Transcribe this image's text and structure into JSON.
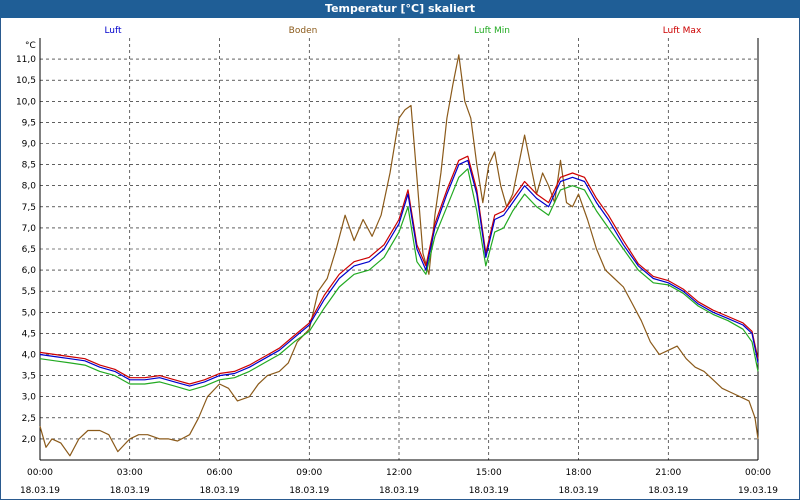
{
  "window": {
    "title": "Temperatur [°C] skaliert"
  },
  "chart_data": {
    "type": "line",
    "title": "Temperatur [°C] skaliert",
    "ylabel": "°C",
    "xlabel": "",
    "ylim": [
      1.5,
      11.5
    ],
    "xlim": [
      0,
      24
    ],
    "grid": true,
    "legend_placement": "top",
    "y_ticks": [
      "2,0",
      "2,5",
      "3,0",
      "3,5",
      "4,0",
      "4,5",
      "5,0",
      "5,5",
      "6,0",
      "6,5",
      "7,0",
      "7,5",
      "8,0",
      "8,5",
      "9,0",
      "9,5",
      "10,0",
      "10,5",
      "11,0"
    ],
    "x_ticks": [
      {
        "time": "00:00",
        "date": "18.03.19"
      },
      {
        "time": "03:00",
        "date": "18.03.19"
      },
      {
        "time": "06:00",
        "date": "18.03.19"
      },
      {
        "time": "09:00",
        "date": "18.03.19"
      },
      {
        "time": "12:00",
        "date": "18.03.19"
      },
      {
        "time": "15:00",
        "date": "18.03.19"
      },
      {
        "time": "18:00",
        "date": "18.03.19"
      },
      {
        "time": "21:00",
        "date": "18.03.19"
      },
      {
        "time": "00:00",
        "date": "19.03.19"
      }
    ],
    "series": [
      {
        "name": "Luft",
        "color": "#0000cc",
        "x": [
          0,
          0.5,
          1,
          1.5,
          2,
          2.5,
          3,
          3.5,
          4,
          4.5,
          5,
          5.5,
          6,
          6.5,
          7,
          7.5,
          8,
          8.5,
          9,
          9.5,
          10,
          10.5,
          11,
          11.5,
          12,
          12.3,
          12.6,
          12.9,
          13.2,
          13.6,
          14,
          14.3,
          14.6,
          14.9,
          15.2,
          15.5,
          15.8,
          16.2,
          16.6,
          17,
          17.4,
          17.8,
          18.2,
          18.6,
          19,
          19.5,
          20,
          20.5,
          21,
          21.5,
          22,
          22.5,
          23,
          23.5,
          23.8,
          24
        ],
        "y": [
          4.0,
          3.95,
          3.9,
          3.85,
          3.7,
          3.6,
          3.4,
          3.4,
          3.45,
          3.35,
          3.25,
          3.35,
          3.5,
          3.55,
          3.7,
          3.9,
          4.1,
          4.4,
          4.7,
          5.3,
          5.8,
          6.1,
          6.2,
          6.5,
          7.1,
          7.8,
          6.5,
          6.0,
          7.0,
          7.8,
          8.5,
          8.6,
          7.8,
          6.3,
          7.2,
          7.3,
          7.6,
          8.0,
          7.7,
          7.5,
          8.1,
          8.2,
          8.1,
          7.6,
          7.2,
          6.6,
          6.1,
          5.8,
          5.7,
          5.5,
          5.2,
          5.0,
          4.85,
          4.7,
          4.5,
          3.8
        ]
      },
      {
        "name": "Boden",
        "color": "#8b5a1a",
        "x": [
          0,
          0.2,
          0.4,
          0.7,
          1,
          1.3,
          1.6,
          2,
          2.3,
          2.6,
          3,
          3.3,
          3.6,
          4,
          4.3,
          4.6,
          5,
          5.3,
          5.6,
          6,
          6.3,
          6.6,
          7,
          7.3,
          7.6,
          8,
          8.3,
          8.6,
          9,
          9.3,
          9.6,
          9.9,
          10.2,
          10.5,
          10.8,
          11.1,
          11.4,
          11.7,
          12,
          12.2,
          12.4,
          12.6,
          12.8,
          13,
          13.2,
          13.4,
          13.6,
          13.8,
          14,
          14.2,
          14.4,
          14.6,
          14.8,
          15,
          15.2,
          15.4,
          15.6,
          15.8,
          16,
          16.2,
          16.4,
          16.6,
          16.8,
          17,
          17.2,
          17.4,
          17.6,
          17.8,
          18,
          18.3,
          18.6,
          18.9,
          19.2,
          19.5,
          19.8,
          20.1,
          20.4,
          20.7,
          21,
          21.3,
          21.6,
          21.9,
          22.2,
          22.5,
          22.8,
          23.1,
          23.4,
          23.7,
          23.9,
          24
        ],
        "y": [
          2.3,
          1.8,
          2.0,
          1.9,
          1.6,
          2.0,
          2.2,
          2.2,
          2.1,
          1.7,
          2.0,
          2.1,
          2.1,
          2.0,
          2.0,
          1.95,
          2.1,
          2.5,
          3.0,
          3.3,
          3.2,
          2.9,
          3.0,
          3.3,
          3.5,
          3.6,
          3.8,
          4.3,
          4.6,
          5.5,
          5.8,
          6.5,
          7.3,
          6.7,
          7.2,
          6.8,
          7.3,
          8.3,
          9.6,
          9.8,
          9.9,
          8.2,
          6.4,
          5.9,
          7.3,
          8.3,
          9.6,
          10.4,
          11.1,
          10.0,
          9.6,
          8.5,
          7.6,
          8.5,
          8.8,
          8.0,
          7.5,
          7.8,
          8.5,
          9.2,
          8.5,
          7.8,
          8.3,
          8.0,
          7.6,
          8.6,
          7.6,
          7.5,
          7.8,
          7.2,
          6.5,
          6.0,
          5.8,
          5.6,
          5.2,
          4.8,
          4.3,
          4.0,
          4.1,
          4.2,
          3.9,
          3.7,
          3.6,
          3.4,
          3.2,
          3.1,
          3.0,
          2.9,
          2.5,
          2.0
        ]
      },
      {
        "name": "Luft Min",
        "color": "#22aa22",
        "x": [
          0,
          0.5,
          1,
          1.5,
          2,
          2.5,
          3,
          3.5,
          4,
          4.5,
          5,
          5.5,
          6,
          6.5,
          7,
          7.5,
          8,
          8.5,
          9,
          9.5,
          10,
          10.5,
          11,
          11.5,
          12,
          12.3,
          12.6,
          12.9,
          13.2,
          13.6,
          14,
          14.3,
          14.6,
          14.9,
          15.2,
          15.5,
          15.8,
          16.2,
          16.6,
          17,
          17.4,
          17.8,
          18.2,
          18.6,
          19,
          19.5,
          20,
          20.5,
          21,
          21.5,
          22,
          22.5,
          23,
          23.5,
          23.8,
          24
        ],
        "y": [
          3.9,
          3.85,
          3.8,
          3.75,
          3.6,
          3.5,
          3.3,
          3.3,
          3.35,
          3.25,
          3.15,
          3.25,
          3.4,
          3.45,
          3.6,
          3.8,
          4.0,
          4.3,
          4.55,
          5.1,
          5.6,
          5.9,
          6.0,
          6.3,
          6.9,
          7.5,
          6.2,
          5.9,
          6.8,
          7.5,
          8.2,
          8.4,
          7.4,
          6.1,
          6.9,
          7.0,
          7.4,
          7.8,
          7.5,
          7.3,
          7.9,
          8.0,
          7.9,
          7.4,
          7.0,
          6.5,
          6.0,
          5.7,
          5.65,
          5.45,
          5.15,
          4.95,
          4.8,
          4.6,
          4.3,
          3.6
        ]
      },
      {
        "name": "Luft Max",
        "color": "#cc0000",
        "x": [
          0,
          0.5,
          1,
          1.5,
          2,
          2.5,
          3,
          3.5,
          4,
          4.5,
          5,
          5.5,
          6,
          6.5,
          7,
          7.5,
          8,
          8.5,
          9,
          9.5,
          10,
          10.5,
          11,
          11.5,
          12,
          12.3,
          12.6,
          12.9,
          13.2,
          13.6,
          14,
          14.3,
          14.6,
          14.9,
          15.2,
          15.5,
          15.8,
          16.2,
          16.6,
          17,
          17.4,
          17.8,
          18.2,
          18.6,
          19,
          19.5,
          20,
          20.5,
          21,
          21.5,
          22,
          22.5,
          23,
          23.5,
          23.8,
          24
        ],
        "y": [
          4.05,
          4.0,
          3.95,
          3.9,
          3.75,
          3.65,
          3.45,
          3.45,
          3.5,
          3.4,
          3.3,
          3.4,
          3.55,
          3.6,
          3.75,
          3.95,
          4.15,
          4.45,
          4.75,
          5.4,
          5.9,
          6.2,
          6.3,
          6.6,
          7.2,
          7.9,
          6.6,
          6.1,
          7.1,
          7.9,
          8.6,
          8.7,
          7.9,
          6.4,
          7.3,
          7.4,
          7.7,
          8.1,
          7.8,
          7.6,
          8.2,
          8.3,
          8.2,
          7.7,
          7.3,
          6.7,
          6.15,
          5.85,
          5.75,
          5.55,
          5.25,
          5.05,
          4.9,
          4.75,
          4.55,
          3.9
        ]
      }
    ]
  }
}
